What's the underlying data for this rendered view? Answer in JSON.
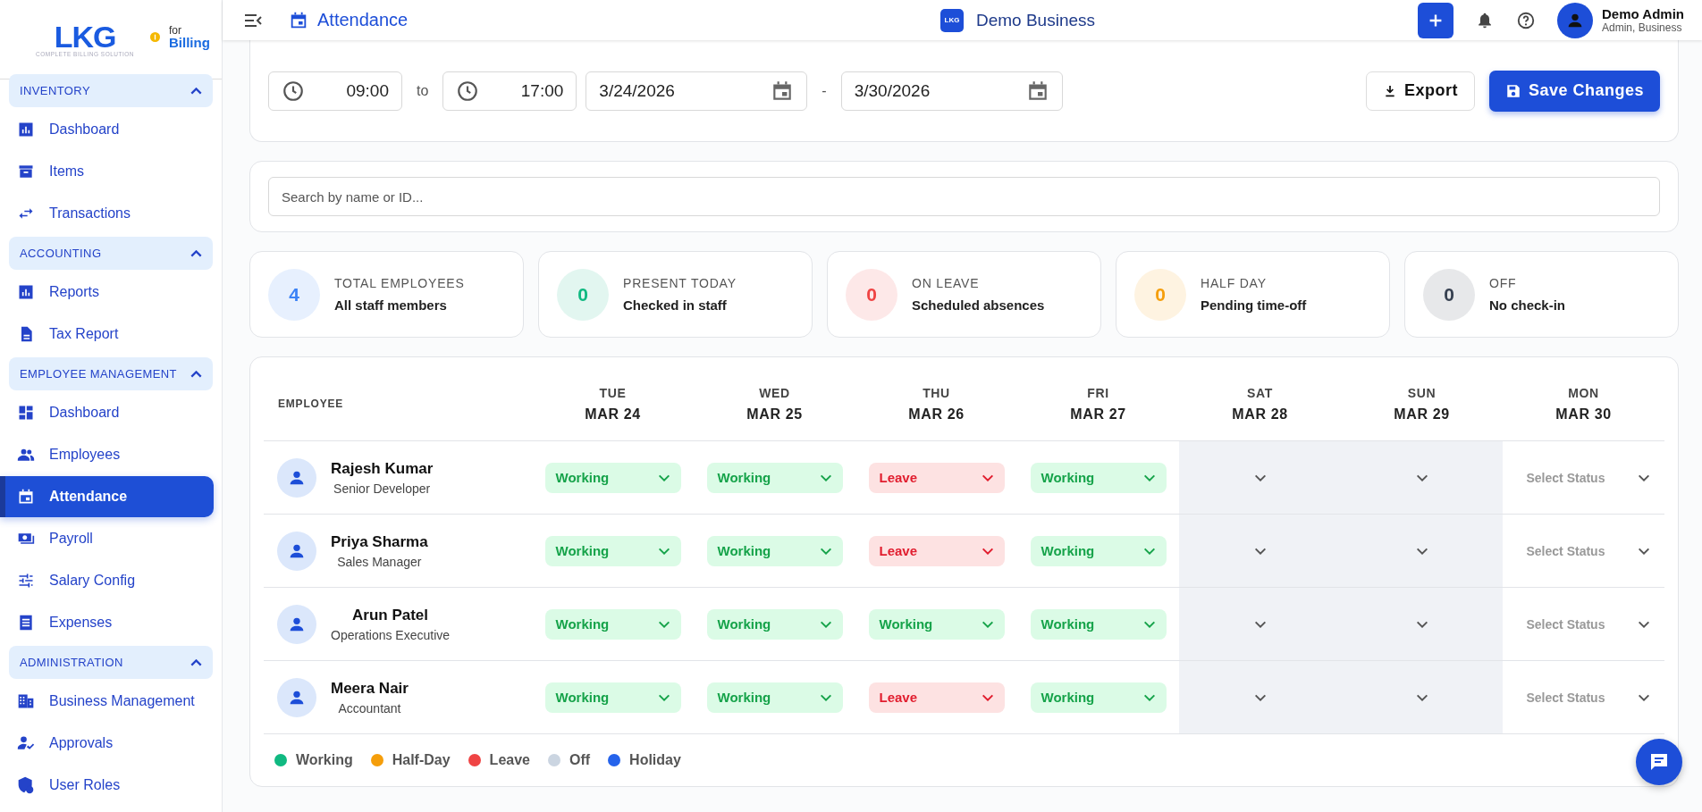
{
  "sidebar": {
    "logo": {
      "brand": "LKG",
      "for": "for",
      "product": "Billing",
      "tagline": "COMPLETE BILLING SOLUTION"
    },
    "sections": [
      {
        "title": "INVENTORY",
        "expanded": true,
        "items": [
          {
            "label": "Dashboard",
            "selected": false
          },
          {
            "label": "Items",
            "selected": false
          },
          {
            "label": "Transactions",
            "selected": false
          }
        ]
      },
      {
        "title": "ACCOUNTING",
        "expanded": true,
        "items": [
          {
            "label": "Reports",
            "selected": false
          },
          {
            "label": "Tax Report",
            "selected": false
          }
        ]
      },
      {
        "title": "EMPLOYEE MANAGEMENT",
        "expanded": true,
        "items": [
          {
            "label": "Dashboard",
            "selected": false
          },
          {
            "label": "Employees",
            "selected": false
          },
          {
            "label": "Attendance",
            "selected": true
          },
          {
            "label": "Payroll",
            "selected": false
          },
          {
            "label": "Salary Config",
            "selected": false
          },
          {
            "label": "Expenses",
            "selected": false
          }
        ]
      },
      {
        "title": "ADMINISTRATION",
        "expanded": true,
        "items": [
          {
            "label": "Business Management",
            "selected": false
          },
          {
            "label": "Approvals",
            "selected": false
          },
          {
            "label": "User Roles",
            "selected": false
          }
        ]
      }
    ]
  },
  "header": {
    "title": "Attendance",
    "business_logo": "LKG",
    "business": "Demo Business",
    "user": {
      "name": "Demo Admin",
      "role": "Admin, Business"
    }
  },
  "filters": {
    "start_time": "09:00",
    "to": "to",
    "end_time": "17:00",
    "start_date": "3/24/2026",
    "dash": "-",
    "end_date": "3/30/2026",
    "export": "Export",
    "save": "Save Changes"
  },
  "search": {
    "placeholder": "Search by name or ID..."
  },
  "stats": [
    {
      "value": "4",
      "title": "TOTAL EMPLOYEES",
      "subtitle": "All staff members",
      "color": "#3b82f6"
    },
    {
      "value": "0",
      "title": "PRESENT TODAY",
      "subtitle": "Checked in staff",
      "color": "#10b981"
    },
    {
      "value": "0",
      "title": "ON LEAVE",
      "subtitle": "Scheduled absences",
      "color": "#ef4444"
    },
    {
      "value": "0",
      "title": "HALF DAY",
      "subtitle": "Pending time-off",
      "color": "#f59e0b"
    },
    {
      "value": "0",
      "title": "OFF",
      "subtitle": "No check-in",
      "color": "#374151"
    }
  ],
  "table": {
    "employee_header": "EMPLOYEE",
    "days": [
      {
        "day": "TUE",
        "date": "MAR 24",
        "weekend": false
      },
      {
        "day": "WED",
        "date": "MAR 25",
        "weekend": false
      },
      {
        "day": "THU",
        "date": "MAR 26",
        "weekend": false
      },
      {
        "day": "FRI",
        "date": "MAR 27",
        "weekend": false
      },
      {
        "day": "SAT",
        "date": "MAR 28",
        "weekend": true
      },
      {
        "day": "SUN",
        "date": "MAR 29",
        "weekend": true
      },
      {
        "day": "MON",
        "date": "MAR 30",
        "weekend": false
      }
    ],
    "rows": [
      {
        "name": "Rajesh Kumar",
        "role": "Senior Developer",
        "cells": [
          {
            "kind": "working",
            "label": "Working"
          },
          {
            "kind": "working",
            "label": "Working"
          },
          {
            "kind": "leave",
            "label": "Leave"
          },
          {
            "kind": "working",
            "label": "Working"
          },
          {
            "kind": "empty"
          },
          {
            "kind": "empty"
          },
          {
            "kind": "unset",
            "placeholder": "Select Status"
          }
        ]
      },
      {
        "name": "Priya Sharma",
        "role": "Sales Manager",
        "cells": [
          {
            "kind": "working",
            "label": "Working"
          },
          {
            "kind": "working",
            "label": "Working"
          },
          {
            "kind": "leave",
            "label": "Leave"
          },
          {
            "kind": "working",
            "label": "Working"
          },
          {
            "kind": "empty"
          },
          {
            "kind": "empty"
          },
          {
            "kind": "unset",
            "placeholder": "Select Status"
          }
        ]
      },
      {
        "name": "Arun Patel",
        "role": "Operations Executive",
        "cells": [
          {
            "kind": "working",
            "label": "Working"
          },
          {
            "kind": "working",
            "label": "Working"
          },
          {
            "kind": "working",
            "label": "Working"
          },
          {
            "kind": "working",
            "label": "Working"
          },
          {
            "kind": "empty"
          },
          {
            "kind": "empty"
          },
          {
            "kind": "unset",
            "placeholder": "Select Status"
          }
        ]
      },
      {
        "name": "Meera Nair",
        "role": "Accountant",
        "cells": [
          {
            "kind": "working",
            "label": "Working"
          },
          {
            "kind": "working",
            "label": "Working"
          },
          {
            "kind": "leave",
            "label": "Leave"
          },
          {
            "kind": "working",
            "label": "Working"
          },
          {
            "kind": "empty"
          },
          {
            "kind": "empty"
          },
          {
            "kind": "unset",
            "placeholder": "Select Status"
          }
        ]
      }
    ]
  },
  "legend": [
    {
      "label": "Working",
      "color": "#10b981"
    },
    {
      "label": "Half-Day",
      "color": "#f59e0b"
    },
    {
      "label": "Leave",
      "color": "#ef4444"
    },
    {
      "label": "Off",
      "color": "#cbd5e1"
    },
    {
      "label": "Holiday",
      "color": "#2563eb"
    }
  ]
}
